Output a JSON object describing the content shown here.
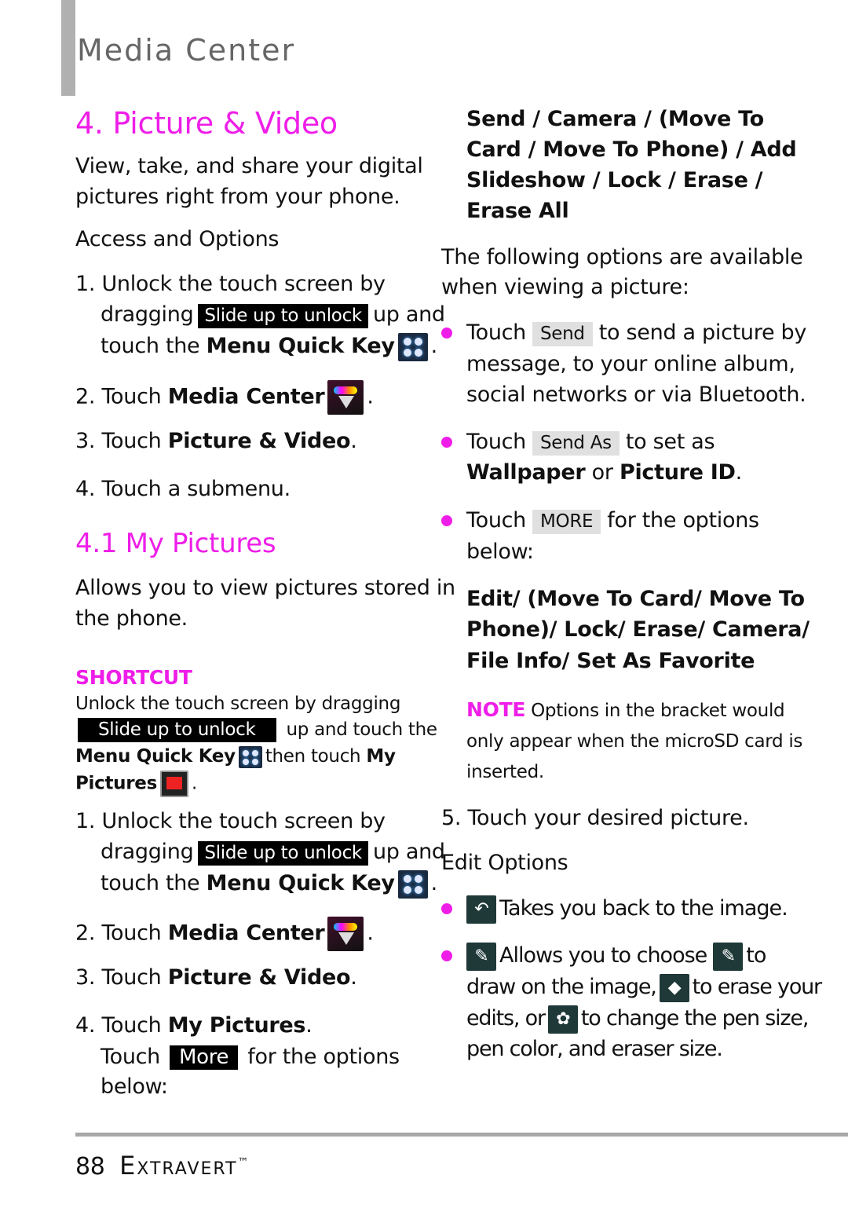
{
  "header": {
    "section": "Media Center"
  },
  "left": {
    "title": "4. Picture & Video",
    "intro": [
      "View, take, and share your digital",
      "pictures right from your phone."
    ],
    "access_heading": "Access and Options",
    "s1a": "1. Unlock the touch screen by",
    "dragging": "dragging",
    "slide": "Slide up to unlock",
    "upand": "up and",
    "touchthe": "touch the",
    "mqk": "Menu Quick Key",
    "dot": ".",
    "s2": "2. Touch",
    "media_center": "Media Center",
    "s3": "3. Touch",
    "picvid": "Picture & Video",
    "s4": "4. Touch a submenu.",
    "sub_title": "4.1 My Pictures",
    "sub_intro": [
      "Allows you to view pictures stored in",
      "the phone."
    ],
    "shortcut": "SHORTCUT",
    "sc1": "Unlock the touch screen by dragging",
    "sc2": "up and touch the",
    "sc3": "then touch",
    "my": "My",
    "pictures": "Pictures",
    "s4b": "4. Touch",
    "mypics": "My Pictures",
    "touch": "Touch",
    "more": "More",
    "for_opts": "for the options",
    "below": "below:"
  },
  "right": {
    "opts1": [
      "Send / Camera / (Move To",
      "Card / Move To Phone) / Add",
      "Slideshow / Lock / Erase /",
      "Erase All"
    ],
    "following": [
      "The following options are available",
      "when viewing a picture:"
    ],
    "touch": "Touch",
    "send": "Send",
    "send_rest": "to send a picture by",
    "send_lines": [
      "message, to your online album,",
      "social networks or via Bluetooth."
    ],
    "sendas": "Send As",
    "sendas_rest": "to set as",
    "wallpaper": "Wallpaper",
    "or": "or",
    "picid": "Picture ID",
    "dot": ".",
    "more": "MORE",
    "more_rest": "for the options",
    "below": "below:",
    "opts2": [
      "Edit/ (Move To Card/ Move To",
      "Phone)/ Lock/ Erase/ Camera/",
      "File Info/ Set As Favorite"
    ],
    "note": "NOTE",
    "note_lines": [
      "Options in the bracket would",
      "only appear when the microSD card is",
      "inserted."
    ],
    "s5": "5. Touch your desired picture.",
    "edit_heading": "Edit Options",
    "back": "Takes you back to the image.",
    "allows": "Allows you to choose",
    "to": "to",
    "draw": "draw on the image,",
    "erase": "to erase your",
    "edits": "edits, or",
    "change": "to change the pen size,",
    "pen": "pen color, and eraser size."
  },
  "footer": {
    "page": "88",
    "brand": "Extravert",
    "tm": "™"
  },
  "colors": {
    "accent": "#ee1ee8",
    "chip": "#000000",
    "button": "#e0e0e0"
  }
}
